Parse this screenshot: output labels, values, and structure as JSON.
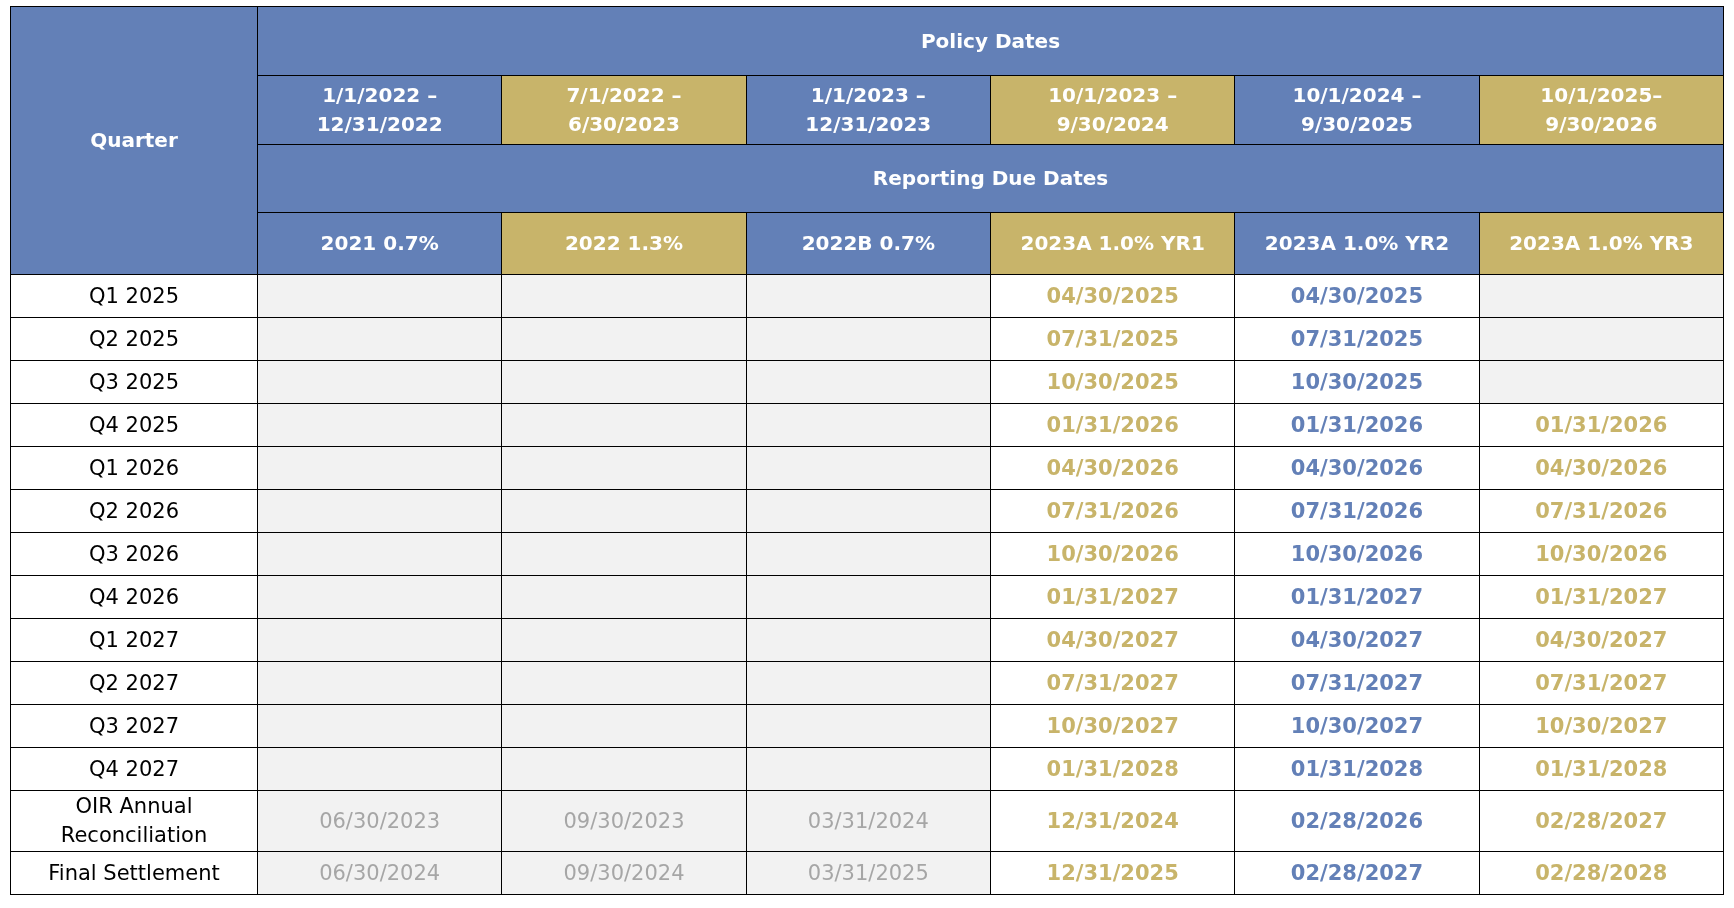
{
  "table": {
    "corner": "Quarter",
    "policy_heading": "Policy Dates",
    "reporting_heading": "Reporting Due Dates",
    "columns": [
      {
        "period": "1/1/2022 –\n12/31/2022",
        "series": "2021 0.7%",
        "color": "#6380b7"
      },
      {
        "period": "7/1/2022 –\n6/30/2023",
        "series": "2022 1.3%",
        "color": "#c8b46a"
      },
      {
        "period": "1/1/2023 –\n12/31/2023",
        "series": "2022B 0.7%",
        "color": "#6380b7"
      },
      {
        "period": "10/1/2023 –\n9/30/2024",
        "series": "2023A 1.0% YR1",
        "color": "#c8b46a"
      },
      {
        "period": "10/1/2024 –\n9/30/2025",
        "series": "2023A 1.0% YR2",
        "color": "#6380b7"
      },
      {
        "period": "10/1/2025–\n9/30/2026",
        "series": "2023A 1.0% YR3",
        "color": "#c8b46a"
      }
    ],
    "rows": [
      {
        "label": "Q1 2025",
        "cells": [
          {
            "kind": "blank"
          },
          {
            "kind": "blank"
          },
          {
            "kind": "blank"
          },
          {
            "kind": "date",
            "text": "04/30/2025"
          },
          {
            "kind": "date",
            "text": "04/30/2025"
          },
          {
            "kind": "blank"
          }
        ]
      },
      {
        "label": "Q2 2025",
        "cells": [
          {
            "kind": "blank"
          },
          {
            "kind": "blank"
          },
          {
            "kind": "blank"
          },
          {
            "kind": "date",
            "text": "07/31/2025"
          },
          {
            "kind": "date",
            "text": "07/31/2025"
          },
          {
            "kind": "blank"
          }
        ]
      },
      {
        "label": "Q3 2025",
        "cells": [
          {
            "kind": "blank"
          },
          {
            "kind": "blank"
          },
          {
            "kind": "blank"
          },
          {
            "kind": "date",
            "text": "10/30/2025"
          },
          {
            "kind": "date",
            "text": "10/30/2025"
          },
          {
            "kind": "blank"
          }
        ]
      },
      {
        "label": "Q4 2025",
        "cells": [
          {
            "kind": "blank"
          },
          {
            "kind": "blank"
          },
          {
            "kind": "blank"
          },
          {
            "kind": "date",
            "text": "01/31/2026"
          },
          {
            "kind": "date",
            "text": "01/31/2026"
          },
          {
            "kind": "date",
            "text": "01/31/2026"
          }
        ]
      },
      {
        "label": "Q1 2026",
        "cells": [
          {
            "kind": "blank"
          },
          {
            "kind": "blank"
          },
          {
            "kind": "blank"
          },
          {
            "kind": "date",
            "text": "04/30/2026"
          },
          {
            "kind": "date",
            "text": "04/30/2026"
          },
          {
            "kind": "date",
            "text": "04/30/2026"
          }
        ]
      },
      {
        "label": "Q2 2026",
        "cells": [
          {
            "kind": "blank"
          },
          {
            "kind": "blank"
          },
          {
            "kind": "blank"
          },
          {
            "kind": "date",
            "text": "07/31/2026"
          },
          {
            "kind": "date",
            "text": "07/31/2026"
          },
          {
            "kind": "date",
            "text": "07/31/2026"
          }
        ]
      },
      {
        "label": "Q3 2026",
        "cells": [
          {
            "kind": "blank"
          },
          {
            "kind": "blank"
          },
          {
            "kind": "blank"
          },
          {
            "kind": "date",
            "text": "10/30/2026"
          },
          {
            "kind": "date",
            "text": "10/30/2026"
          },
          {
            "kind": "date",
            "text": "10/30/2026"
          }
        ]
      },
      {
        "label": "Q4 2026",
        "cells": [
          {
            "kind": "blank"
          },
          {
            "kind": "blank"
          },
          {
            "kind": "blank"
          },
          {
            "kind": "date",
            "text": "01/31/2027"
          },
          {
            "kind": "date",
            "text": "01/31/2027"
          },
          {
            "kind": "date",
            "text": "01/31/2027"
          }
        ]
      },
      {
        "label": "Q1 2027",
        "cells": [
          {
            "kind": "blank"
          },
          {
            "kind": "blank"
          },
          {
            "kind": "blank"
          },
          {
            "kind": "date",
            "text": "04/30/2027"
          },
          {
            "kind": "date",
            "text": "04/30/2027"
          },
          {
            "kind": "date",
            "text": "04/30/2027"
          }
        ]
      },
      {
        "label": "Q2 2027",
        "cells": [
          {
            "kind": "blank"
          },
          {
            "kind": "blank"
          },
          {
            "kind": "blank"
          },
          {
            "kind": "date",
            "text": "07/31/2027"
          },
          {
            "kind": "date",
            "text": "07/31/2027"
          },
          {
            "kind": "date",
            "text": "07/31/2027"
          }
        ]
      },
      {
        "label": "Q3 2027",
        "cells": [
          {
            "kind": "blank"
          },
          {
            "kind": "blank"
          },
          {
            "kind": "blank"
          },
          {
            "kind": "date",
            "text": "10/30/2027"
          },
          {
            "kind": "date",
            "text": "10/30/2027"
          },
          {
            "kind": "date",
            "text": "10/30/2027"
          }
        ]
      },
      {
        "label": "Q4 2027",
        "cells": [
          {
            "kind": "blank"
          },
          {
            "kind": "blank"
          },
          {
            "kind": "blank"
          },
          {
            "kind": "date",
            "text": "01/31/2028"
          },
          {
            "kind": "date",
            "text": "01/31/2028"
          },
          {
            "kind": "date",
            "text": "01/31/2028"
          }
        ]
      },
      {
        "label": "OIR Annual\nReconciliation",
        "cells": [
          {
            "kind": "past",
            "text": "06/30/2023"
          },
          {
            "kind": "past",
            "text": "09/30/2023"
          },
          {
            "kind": "past",
            "text": "03/31/2024"
          },
          {
            "kind": "date",
            "text": "12/31/2024"
          },
          {
            "kind": "date",
            "text": "02/28/2026"
          },
          {
            "kind": "date",
            "text": "02/28/2027"
          }
        ]
      },
      {
        "label": "Final Settlement",
        "cells": [
          {
            "kind": "past",
            "text": "06/30/2024"
          },
          {
            "kind": "past",
            "text": "09/30/2024"
          },
          {
            "kind": "past",
            "text": "03/31/2025"
          },
          {
            "kind": "date",
            "text": "12/31/2025"
          },
          {
            "kind": "date",
            "text": "02/28/2027"
          },
          {
            "kind": "date",
            "text": "02/28/2028"
          }
        ]
      }
    ]
  }
}
